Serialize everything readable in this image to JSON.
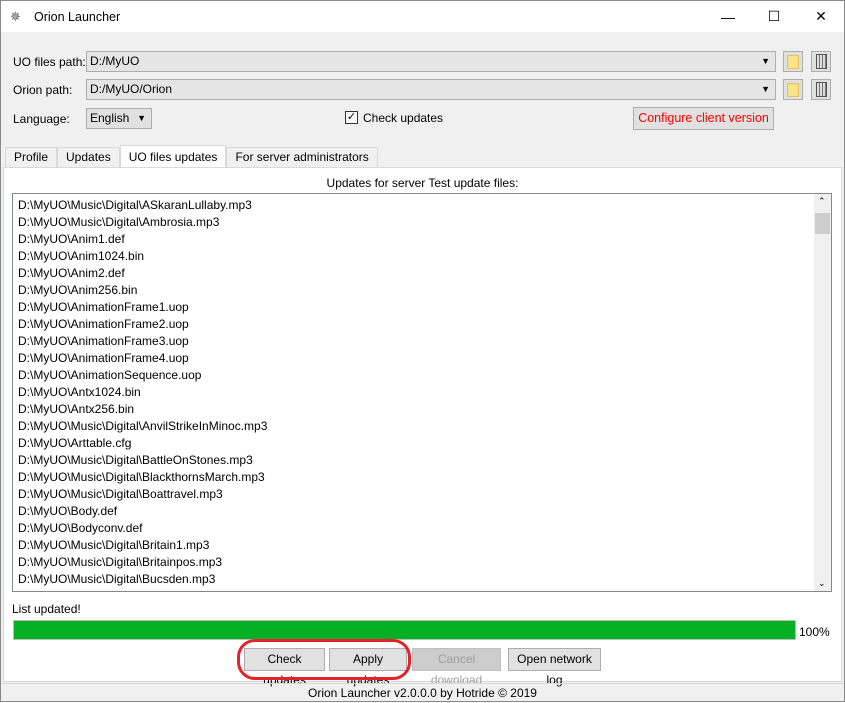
{
  "window": {
    "title": "Orion Launcher",
    "icon": "orion-app-icon"
  },
  "paths": {
    "uo_label": "UO files path:",
    "uo_value": "D:/MyUO",
    "orion_label": "Orion path:",
    "orion_value": "D:/MyUO/Orion",
    "language_label": "Language:",
    "language_value": "English",
    "check_updates_label": "Check updates",
    "check_updates_checked": true,
    "configure_button": "Configure client version",
    "configure_color": "#ff0000"
  },
  "tabs": [
    {
      "label": "Profile"
    },
    {
      "label": "Updates"
    },
    {
      "label": "UO files updates",
      "active": true
    },
    {
      "label": "For server administrators"
    }
  ],
  "main": {
    "heading": "Updates for server Test update files:",
    "files": [
      "D:\\MyUO\\Music\\Digital\\ASkaranLullaby.mp3",
      "D:\\MyUO\\Music\\Digital\\Ambrosia.mp3",
      "D:\\MyUO\\Anim1.def",
      "D:\\MyUO\\Anim1024.bin",
      "D:\\MyUO\\Anim2.def",
      "D:\\MyUO\\Anim256.bin",
      "D:\\MyUO\\AnimationFrame1.uop",
      "D:\\MyUO\\AnimationFrame2.uop",
      "D:\\MyUO\\AnimationFrame3.uop",
      "D:\\MyUO\\AnimationFrame4.uop",
      "D:\\MyUO\\AnimationSequence.uop",
      "D:\\MyUO\\Antx1024.bin",
      "D:\\MyUO\\Antx256.bin",
      "D:\\MyUO\\Music\\Digital\\AnvilStrikeInMinoc.mp3",
      "D:\\MyUO\\Arttable.cfg",
      "D:\\MyUO\\Music\\Digital\\BattleOnStones.mp3",
      "D:\\MyUO\\Music\\Digital\\BlackthornsMarch.mp3",
      "D:\\MyUO\\Music\\Digital\\Boattravel.mp3",
      "D:\\MyUO\\Body.def",
      "D:\\MyUO\\Bodyconv.def",
      "D:\\MyUO\\Music\\Digital\\Britain1.mp3",
      "D:\\MyUO\\Music\\Digital\\Britainpos.mp3",
      "D:\\MyUO\\Music\\Digital\\Bucsden.mp3"
    ],
    "status_text": "List updated!",
    "progress_percent": 100,
    "progress_label": "100%",
    "progress_color": "#06b025",
    "buttons": {
      "check": "Check updates",
      "apply": "Apply updates",
      "cancel": "Cancel download",
      "log": "Open network log"
    },
    "highlight_color": "#e8202a"
  },
  "footer": "Orion Launcher v2.0.0.0 by Hotride © 2019"
}
